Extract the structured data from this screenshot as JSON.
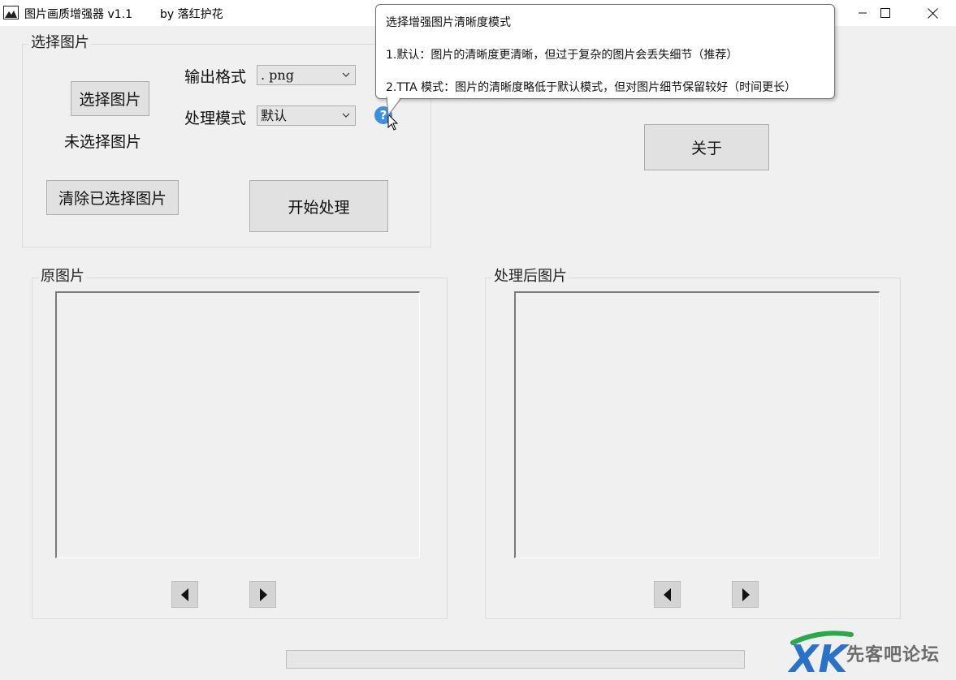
{
  "window": {
    "title": "图片画质增强器 v1.1",
    "author": "by 落红护花",
    "controls": [
      "minimize-icon",
      "maximize-icon",
      "close-icon"
    ]
  },
  "select_group": {
    "title": "选择图片",
    "select_button": "选择图片",
    "status_text": "未选择图片",
    "output_format_label": "输出格式",
    "output_format_value": ". png",
    "process_mode_label": "处理模式",
    "process_mode_value": "默认",
    "clear_button": "清除已选择图片",
    "start_button": "开始处理",
    "help_icon_glyph": "?"
  },
  "about_button": "关于",
  "original_group": {
    "title": "原图片"
  },
  "processed_group": {
    "title": "处理后图片"
  },
  "tooltip": {
    "title": "选择增强图片清晰度模式",
    "line1": "1.默认：图片的清晰度更清晰，但过于复杂的图片会丢失细节（推荐）",
    "line2": "2.TTA 模式：图片的清晰度略低于默认模式，但对图片细节保留较好（时间更长）"
  },
  "progress": {
    "value": 0
  },
  "watermark": {
    "text": "先客吧论坛"
  },
  "colors": {
    "background": "#f0f0f0",
    "help_icon": "#3b8fdc",
    "watermark_green": "#2aa84a",
    "watermark_blue": "#2a72c8"
  }
}
